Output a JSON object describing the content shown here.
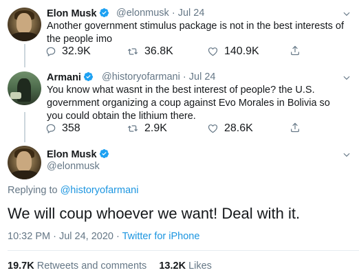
{
  "tweets": [
    {
      "name": "Elon Musk",
      "handle": "@elonmusk",
      "sep": "·",
      "date": "Jul 24",
      "text": "Another government stimulus package is not in the best interests of the people imo",
      "replies": "32.9K",
      "retweets": "36.8K",
      "likes": "140.9K"
    },
    {
      "name": "Armani",
      "handle": "@historyofarmani",
      "sep": "·",
      "date": "Jul 24",
      "text": "You know what wasnt in the best interest of people? the U.S. government organizing a coup against Evo Morales in Bolivia so you could obtain the lithium there.",
      "replies": "358",
      "retweets": "2.9K",
      "likes": "28.6K"
    }
  ],
  "main": {
    "name": "Elon Musk",
    "handle": "@elonmusk",
    "replying_prefix": "Replying to",
    "replying_to": "@historyofarmani",
    "text": "We will coup whoever we want! Deal with it.",
    "time_date": "10:32 PM · Jul 24, 2020 · ",
    "source": "Twitter for iPhone",
    "retweets_count": "19.7K",
    "retweets_label": "Retweets and comments",
    "likes_count": "13.2K",
    "likes_label": "Likes"
  },
  "colors": {
    "accent": "#1b95e0",
    "verified": "#1da1f2",
    "muted": "#657786"
  },
  "icons": [
    "reply-icon",
    "retweet-icon",
    "like-icon",
    "share-icon",
    "verified-icon",
    "chevron-down-icon"
  ]
}
